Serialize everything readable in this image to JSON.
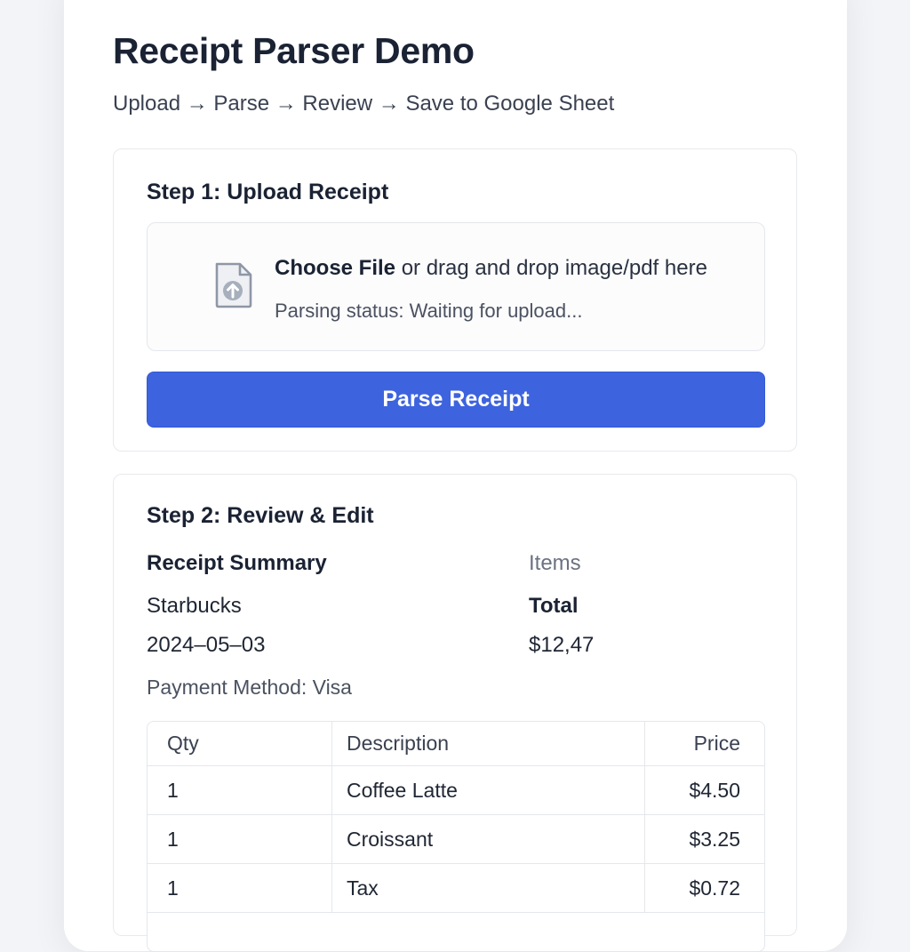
{
  "header": {
    "title": "Receipt Parser Demo",
    "flow": "Upload → Parse → Review → Save to Google Sheet"
  },
  "step1": {
    "title": "Step 1: Upload Receipt",
    "dropzone": {
      "icon": "file-upload-icon",
      "choose_label": "Choose File",
      "drop_text": " or drag and drop image/pdf here",
      "status": "Parsing status: Waiting for upload..."
    },
    "parse_button": "Parse Receipt"
  },
  "step2": {
    "title": "Step 2: Review & Edit",
    "summary": {
      "heading": "Receipt Summary",
      "merchant": "Starbucks",
      "date": "2024–05–03",
      "payment": "Payment Method: Visa",
      "items_label": "Items",
      "total_label": "Total",
      "total_value": "$12,47"
    },
    "table": {
      "columns": [
        "Qty",
        "Description",
        "Price"
      ],
      "rows": [
        [
          "1",
          "Coffee Latte",
          "$4.50"
        ],
        [
          "1",
          "Croissant",
          "$3.25"
        ],
        [
          "1",
          "Tax",
          "$0.72"
        ]
      ]
    }
  },
  "colors": {
    "primary": "#3d63df",
    "background": "#f3f4f7",
    "card": "#ffffff",
    "border": "#e4e7ec"
  }
}
